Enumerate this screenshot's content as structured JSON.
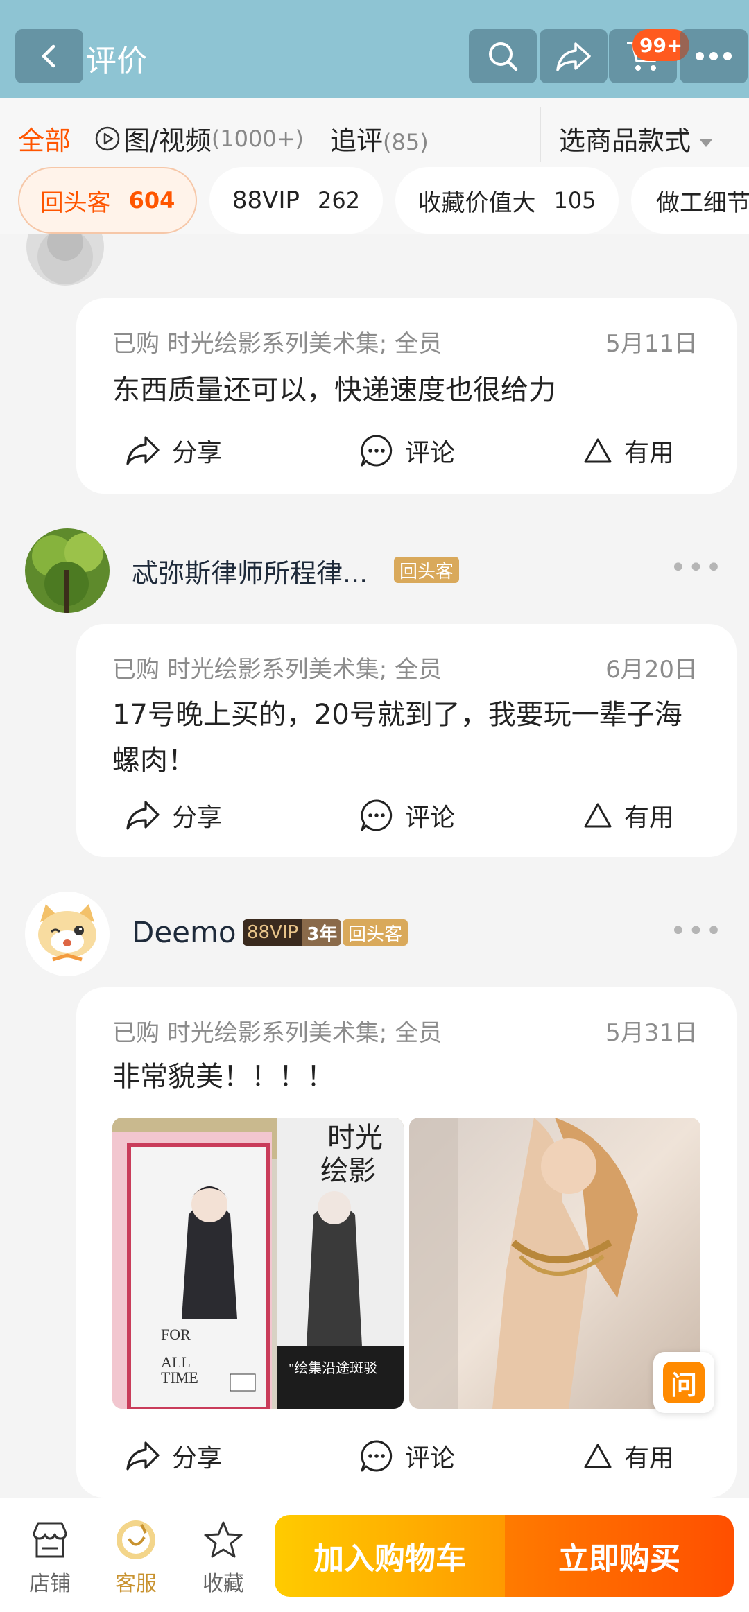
{
  "header": {
    "title": "评价",
    "cart_badge": "99+"
  },
  "tabs": [
    {
      "label": "全部",
      "count": ""
    },
    {
      "label": "图/视频",
      "count": "(1000+)"
    },
    {
      "label": "追评",
      "count": "(85)"
    }
  ],
  "style_selector": "选商品款式",
  "chips": [
    {
      "label": "回头客",
      "count": "604"
    },
    {
      "label": "88VIP",
      "count": "262"
    },
    {
      "label": "收藏价值大",
      "count": "105"
    },
    {
      "label": "做工细节"
    }
  ],
  "reviews": [
    {
      "purchase": "已购 时光绘影系列美术集; 全员",
      "date": "5月11日",
      "text": "东西质量还可以，快递速度也很给力"
    },
    {
      "username": "忒弥斯律师所程律...",
      "tag_return": "回头客",
      "purchase": "已购 时光绘影系列美术集; 全员",
      "date": "6月20日",
      "text": "17号晚上买的，20号就到了，我要玩一辈子海螺肉！"
    },
    {
      "username": "Deemo",
      "tag_vip": "88VIP",
      "tag_years": "3年",
      "tag_return": "回头客",
      "purchase": "已购 时光绘影系列美术集; 全员",
      "date": "5月31日",
      "text": "非常貌美！！！！",
      "photo1_text": "时光\n绘影",
      "photo1_caption": "FOR\nALL\nTIME",
      "photo1_slogan": "\"绘集沿途斑驳"
    }
  ],
  "actions": {
    "share": "分享",
    "comment": "评论",
    "useful": "有用"
  },
  "ask_label": "问",
  "bottom": {
    "store": "店铺",
    "service": "客服",
    "favorite": "收藏",
    "add_cart": "加入购物车",
    "buy_now": "立即购买"
  },
  "colors": {
    "header": "#8ec4d3",
    "accent": "#ff5500",
    "return_tag": "#d9a95b",
    "cta_cart": "#ffb300",
    "cta_buy": "#ff5a00"
  }
}
